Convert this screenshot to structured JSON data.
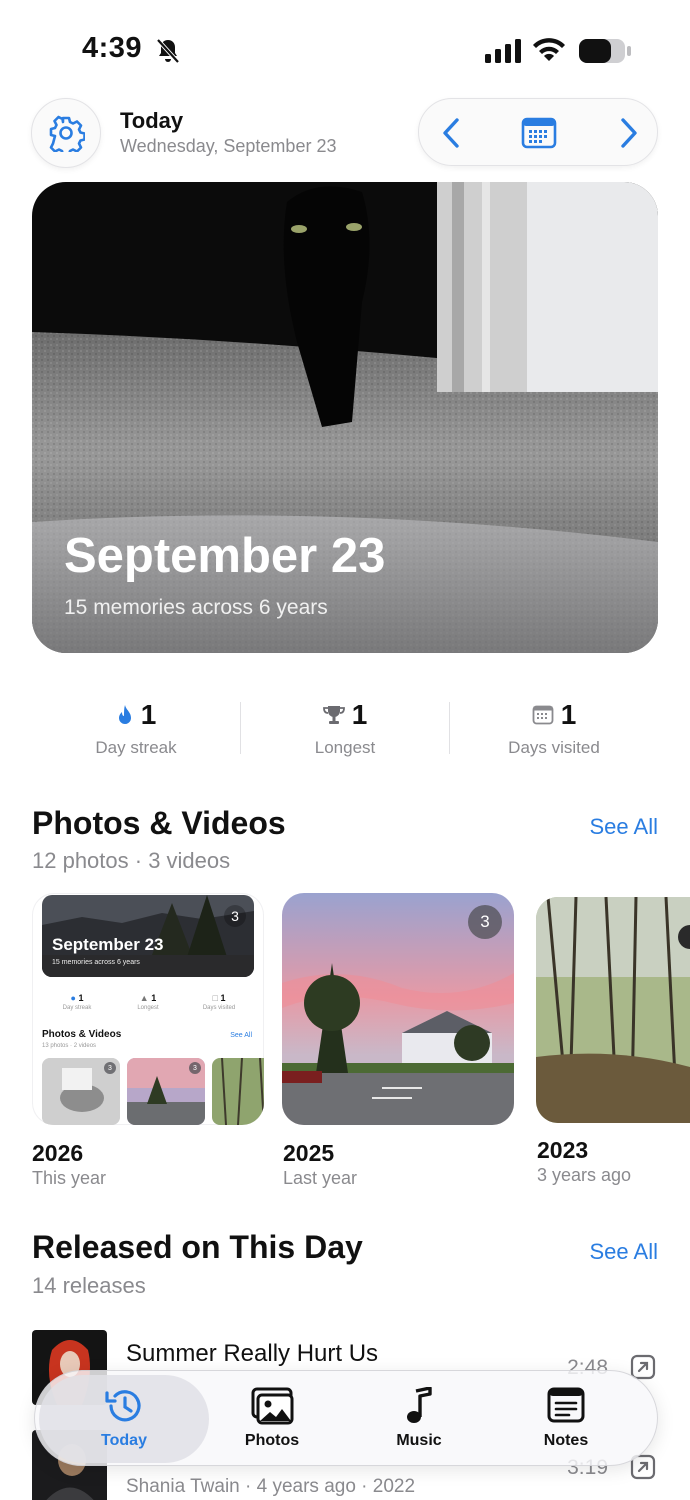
{
  "status_bar": {
    "time": "4:39"
  },
  "header": {
    "title": "Today",
    "subtitle": "Wednesday, September 23"
  },
  "hero": {
    "title": "September 23",
    "subtitle": "15 memories across 6 years"
  },
  "stats": [
    {
      "value": "1",
      "label": "Day streak",
      "icon": "flame-icon"
    },
    {
      "value": "1",
      "label": "Longest",
      "icon": "trophy-icon"
    },
    {
      "value": "1",
      "label": "Days visited",
      "icon": "calendar-icon"
    }
  ],
  "photos": {
    "title": "Photos & Videos",
    "subtitle": "12 photos · 3 videos",
    "see_all": "See All",
    "cards": [
      {
        "year": "2026",
        "ago": "This year",
        "count": "3",
        "preview": {
          "hero_title": "September 23",
          "hero_subtitle": "15 memories across 6 years",
          "stats": [
            {
              "value": "1",
              "label": "Day streak"
            },
            {
              "value": "1",
              "label": "Longest"
            },
            {
              "value": "1",
              "label": "Days visited"
            }
          ],
          "section_title": "Photos & Videos",
          "section_subtitle": "13 photos · 2 videos",
          "see_all": "See All",
          "badges": [
            "3",
            "3"
          ]
        }
      },
      {
        "year": "2025",
        "ago": "Last year",
        "count": "3"
      },
      {
        "year": "2023",
        "ago": "3 years ago"
      }
    ]
  },
  "releases": {
    "title": "Released on This Day",
    "subtitle": "14 releases",
    "see_all": "See All",
    "items": [
      {
        "title": "Summer Really Hurt Us",
        "subtitle": "",
        "duration": "2:48"
      },
      {
        "title": "",
        "subtitle": "Shania Twain · 4 years ago · 2022",
        "duration": "3:19"
      }
    ]
  },
  "tabs": [
    {
      "label": "Today",
      "active": true
    },
    {
      "label": "Photos",
      "active": false
    },
    {
      "label": "Music",
      "active": false
    },
    {
      "label": "Notes",
      "active": false
    }
  ],
  "colors": {
    "accent": "#2a7de1",
    "text": "#111111",
    "secondary": "#8a8a8e"
  }
}
